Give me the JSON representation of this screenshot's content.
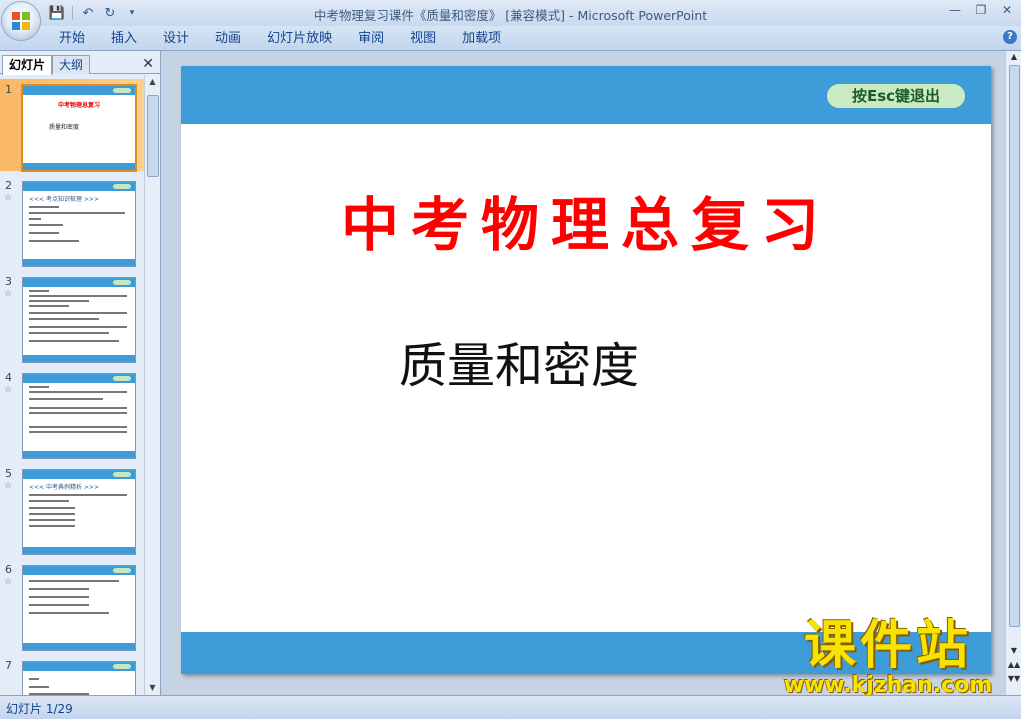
{
  "window": {
    "title": "中考物理复习课件《质量和密度》 [兼容模式] - Microsoft PowerPoint"
  },
  "ribbon": {
    "tabs": [
      "开始",
      "插入",
      "设计",
      "动画",
      "幻灯片放映",
      "审阅",
      "视图",
      "加载项"
    ]
  },
  "left_pane": {
    "tabs": [
      "幻灯片",
      "大纲"
    ],
    "active_tab": "幻灯片",
    "thumbnails": [
      {
        "number": "1",
        "title": "中考物理总复习",
        "subtitle": "质量和密度"
      },
      {
        "number": "2",
        "header": "<<< 考点知识梳理 >>>"
      },
      {
        "number": "3"
      },
      {
        "number": "4"
      },
      {
        "number": "5",
        "header": "<<< 中考典例精析 >>>"
      },
      {
        "number": "6"
      },
      {
        "number": "7"
      }
    ]
  },
  "slide": {
    "esc_button": "按Esc键退出",
    "title": "中考物理总复习",
    "subtitle": "质量和密度"
  },
  "watermark": {
    "title": "课件站",
    "url": "www.kjzhan.com"
  },
  "statusbar": {
    "slide_counter": "幻灯片 1/29"
  },
  "colors": {
    "slide_band": "#3d9bd8",
    "title_red": "#ff0000",
    "selected_thumb": "#f9b765"
  }
}
